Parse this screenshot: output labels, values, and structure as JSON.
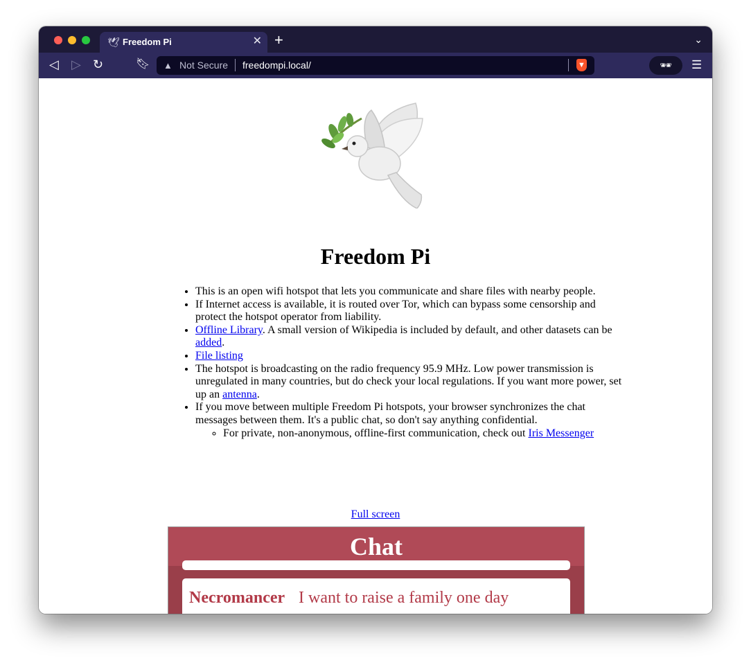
{
  "browser": {
    "tab": {
      "title": "Freedom Pi",
      "icon": "dove-icon",
      "close_glyph": "✕"
    },
    "new_tab_glyph": "+",
    "address_bar": {
      "security_label": "Not Secure",
      "url": "freedompi.local/"
    }
  },
  "page": {
    "title": "Freedom Pi",
    "bullets": {
      "item1": "This is an open wifi hotspot that lets you communicate and share files with nearby people.",
      "item2": "If Internet access is available, it is routed over Tor, which can bypass some censorship and protect the hotspot operator from liability.",
      "item3_link": "Offline Library",
      "item3_text_a": ". A small version of Wikipedia is included by default, and other datasets can be ",
      "item3_link2": "added",
      "item3_text_b": ".",
      "item4_link": "File listing",
      "item5_text_a": "The hotspot is broadcasting on the radio frequency 95.9 MHz. Low power transmission is unregulated in many countries, but do check your local regulations. If you want more power, set up an ",
      "item5_link": "antenna",
      "item5_text_b": ".",
      "item6": "If you move between multiple Freedom Pi hotspots, your browser synchronizes the chat messages between them. It's a public chat, so don't say anything confidential.",
      "item6_sub_text": "For private, non-anonymous, offline-first communication, check out ",
      "item6_sub_link": "Iris Messenger"
    },
    "fullscreen_link": "Full screen",
    "chat": {
      "title": "Chat",
      "messages": [
        {
          "user": "Necromancer",
          "text": "I want to raise a family one day"
        }
      ]
    }
  },
  "colors": {
    "browser_chrome": "#2e2a5c",
    "tab_strip": "#1d1a37",
    "chat_header": "#b04a57",
    "chat_text": "#b23a48",
    "link": "#0000ee"
  }
}
